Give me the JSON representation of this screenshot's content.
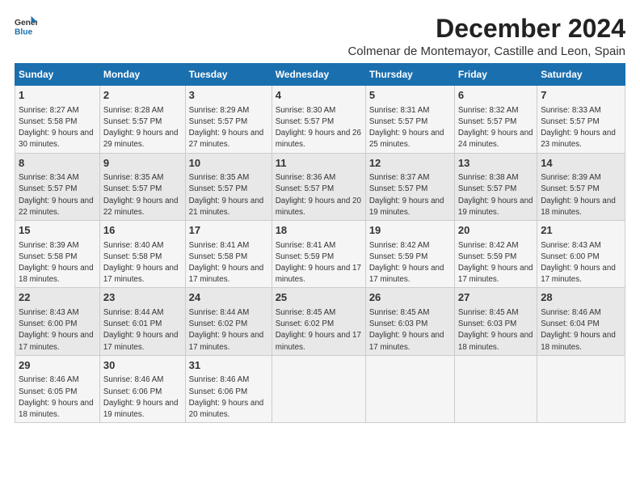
{
  "header": {
    "logo_general": "General",
    "logo_blue": "Blue",
    "title": "December 2024",
    "subtitle": "Colmenar de Montemayor, Castille and Leon, Spain"
  },
  "days_of_week": [
    "Sunday",
    "Monday",
    "Tuesday",
    "Wednesday",
    "Thursday",
    "Friday",
    "Saturday"
  ],
  "weeks": [
    {
      "days": [
        {
          "num": "1",
          "rise": "8:27 AM",
          "set": "5:58 PM",
          "daylight": "9 hours and 30 minutes."
        },
        {
          "num": "2",
          "rise": "8:28 AM",
          "set": "5:57 PM",
          "daylight": "9 hours and 29 minutes."
        },
        {
          "num": "3",
          "rise": "8:29 AM",
          "set": "5:57 PM",
          "daylight": "9 hours and 27 minutes."
        },
        {
          "num": "4",
          "rise": "8:30 AM",
          "set": "5:57 PM",
          "daylight": "9 hours and 26 minutes."
        },
        {
          "num": "5",
          "rise": "8:31 AM",
          "set": "5:57 PM",
          "daylight": "9 hours and 25 minutes."
        },
        {
          "num": "6",
          "rise": "8:32 AM",
          "set": "5:57 PM",
          "daylight": "9 hours and 24 minutes."
        },
        {
          "num": "7",
          "rise": "8:33 AM",
          "set": "5:57 PM",
          "daylight": "9 hours and 23 minutes."
        }
      ]
    },
    {
      "days": [
        {
          "num": "8",
          "rise": "8:34 AM",
          "set": "5:57 PM",
          "daylight": "9 hours and 22 minutes."
        },
        {
          "num": "9",
          "rise": "8:35 AM",
          "set": "5:57 PM",
          "daylight": "9 hours and 22 minutes."
        },
        {
          "num": "10",
          "rise": "8:35 AM",
          "set": "5:57 PM",
          "daylight": "9 hours and 21 minutes."
        },
        {
          "num": "11",
          "rise": "8:36 AM",
          "set": "5:57 PM",
          "daylight": "9 hours and 20 minutes."
        },
        {
          "num": "12",
          "rise": "8:37 AM",
          "set": "5:57 PM",
          "daylight": "9 hours and 19 minutes."
        },
        {
          "num": "13",
          "rise": "8:38 AM",
          "set": "5:57 PM",
          "daylight": "9 hours and 19 minutes."
        },
        {
          "num": "14",
          "rise": "8:39 AM",
          "set": "5:57 PM",
          "daylight": "9 hours and 18 minutes."
        }
      ]
    },
    {
      "days": [
        {
          "num": "15",
          "rise": "8:39 AM",
          "set": "5:58 PM",
          "daylight": "9 hours and 18 minutes."
        },
        {
          "num": "16",
          "rise": "8:40 AM",
          "set": "5:58 PM",
          "daylight": "9 hours and 17 minutes."
        },
        {
          "num": "17",
          "rise": "8:41 AM",
          "set": "5:58 PM",
          "daylight": "9 hours and 17 minutes."
        },
        {
          "num": "18",
          "rise": "8:41 AM",
          "set": "5:59 PM",
          "daylight": "9 hours and 17 minutes."
        },
        {
          "num": "19",
          "rise": "8:42 AM",
          "set": "5:59 PM",
          "daylight": "9 hours and 17 minutes."
        },
        {
          "num": "20",
          "rise": "8:42 AM",
          "set": "5:59 PM",
          "daylight": "9 hours and 17 minutes."
        },
        {
          "num": "21",
          "rise": "8:43 AM",
          "set": "6:00 PM",
          "daylight": "9 hours and 17 minutes."
        }
      ]
    },
    {
      "days": [
        {
          "num": "22",
          "rise": "8:43 AM",
          "set": "6:00 PM",
          "daylight": "9 hours and 17 minutes."
        },
        {
          "num": "23",
          "rise": "8:44 AM",
          "set": "6:01 PM",
          "daylight": "9 hours and 17 minutes."
        },
        {
          "num": "24",
          "rise": "8:44 AM",
          "set": "6:02 PM",
          "daylight": "9 hours and 17 minutes."
        },
        {
          "num": "25",
          "rise": "8:45 AM",
          "set": "6:02 PM",
          "daylight": "9 hours and 17 minutes."
        },
        {
          "num": "26",
          "rise": "8:45 AM",
          "set": "6:03 PM",
          "daylight": "9 hours and 17 minutes."
        },
        {
          "num": "27",
          "rise": "8:45 AM",
          "set": "6:03 PM",
          "daylight": "9 hours and 18 minutes."
        },
        {
          "num": "28",
          "rise": "8:46 AM",
          "set": "6:04 PM",
          "daylight": "9 hours and 18 minutes."
        }
      ]
    },
    {
      "days": [
        {
          "num": "29",
          "rise": "8:46 AM",
          "set": "6:05 PM",
          "daylight": "9 hours and 18 minutes."
        },
        {
          "num": "30",
          "rise": "8:46 AM",
          "set": "6:06 PM",
          "daylight": "9 hours and 19 minutes."
        },
        {
          "num": "31",
          "rise": "8:46 AM",
          "set": "6:06 PM",
          "daylight": "9 hours and 20 minutes."
        },
        null,
        null,
        null,
        null
      ]
    }
  ],
  "labels": {
    "sunrise": "Sunrise:",
    "sunset": "Sunset:",
    "daylight": "Daylight:"
  }
}
